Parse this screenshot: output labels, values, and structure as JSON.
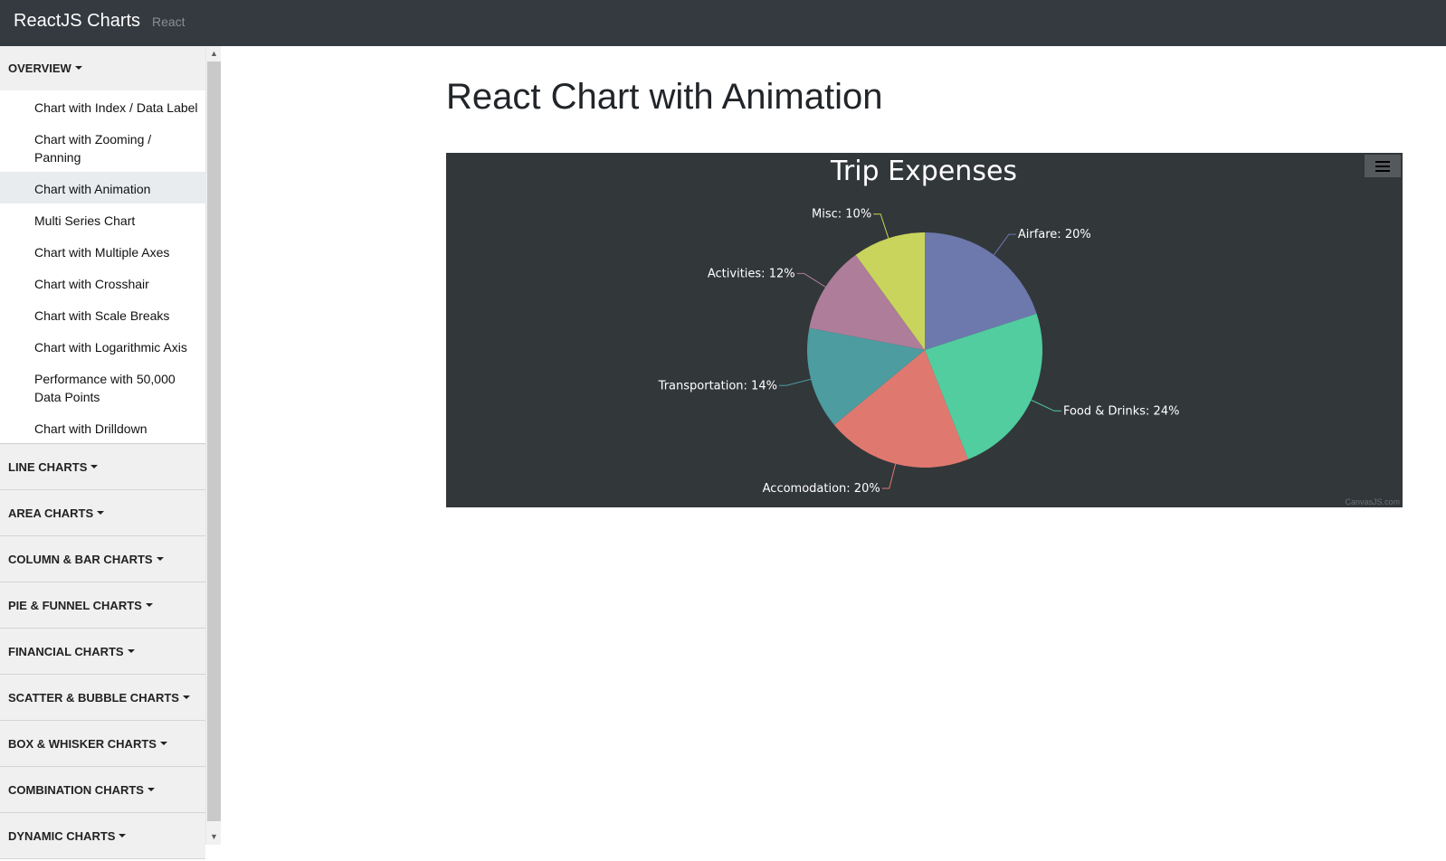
{
  "navbar": {
    "brand": "ReactJS Charts",
    "subtitle": "React"
  },
  "sidebar": {
    "overview": {
      "label": "OVERVIEW",
      "items": [
        {
          "label": "Chart with Index / Data Label"
        },
        {
          "label": "Chart with Zooming / Panning"
        },
        {
          "label": "Chart with Animation",
          "active": true
        },
        {
          "label": "Multi Series Chart"
        },
        {
          "label": "Chart with Multiple Axes"
        },
        {
          "label": "Chart with Crosshair"
        },
        {
          "label": "Chart with Scale Breaks"
        },
        {
          "label": "Chart with Logarithmic Axis"
        },
        {
          "label": "Performance with 50,000 Data Points"
        },
        {
          "label": "Chart with Drilldown"
        }
      ]
    },
    "categories": [
      {
        "label": "LINE CHARTS"
      },
      {
        "label": "AREA CHARTS"
      },
      {
        "label": "COLUMN & BAR CHARTS"
      },
      {
        "label": "PIE & FUNNEL CHARTS"
      },
      {
        "label": "FINANCIAL CHARTS"
      },
      {
        "label": "SCATTER & BUBBLE CHARTS"
      },
      {
        "label": "BOX & WHISKER CHARTS"
      },
      {
        "label": "COMBINATION CHARTS"
      },
      {
        "label": "DYNAMIC CHARTS"
      }
    ]
  },
  "main": {
    "title": "React Chart with Animation",
    "menu_icon": "hamburger-menu-icon",
    "credit": "CanvasJS.com"
  },
  "colors": {
    "chart_background": "#32373a",
    "navbar": "#343a40"
  },
  "chart_data": {
    "type": "pie",
    "title": "Trip Expenses",
    "start_angle_deg": -90,
    "slices": [
      {
        "label": "Airfare",
        "value": 20,
        "display": "Airfare: 20%",
        "color": "#6d78ad"
      },
      {
        "label": "Food & Drinks",
        "value": 24,
        "display": "Food & Drinks: 24%",
        "color": "#51cda0"
      },
      {
        "label": "Accomodation",
        "value": 20,
        "display": "Accomodation: 20%",
        "color": "#df7970"
      },
      {
        "label": "Transportation",
        "value": 14,
        "display": "Transportation: 14%",
        "color": "#4c9ca0"
      },
      {
        "label": "Activities",
        "value": 12,
        "display": "Activities: 12%",
        "color": "#ae7d99"
      },
      {
        "label": "Misc",
        "value": 10,
        "display": "Misc: 10%",
        "color": "#c9d45c"
      }
    ]
  }
}
